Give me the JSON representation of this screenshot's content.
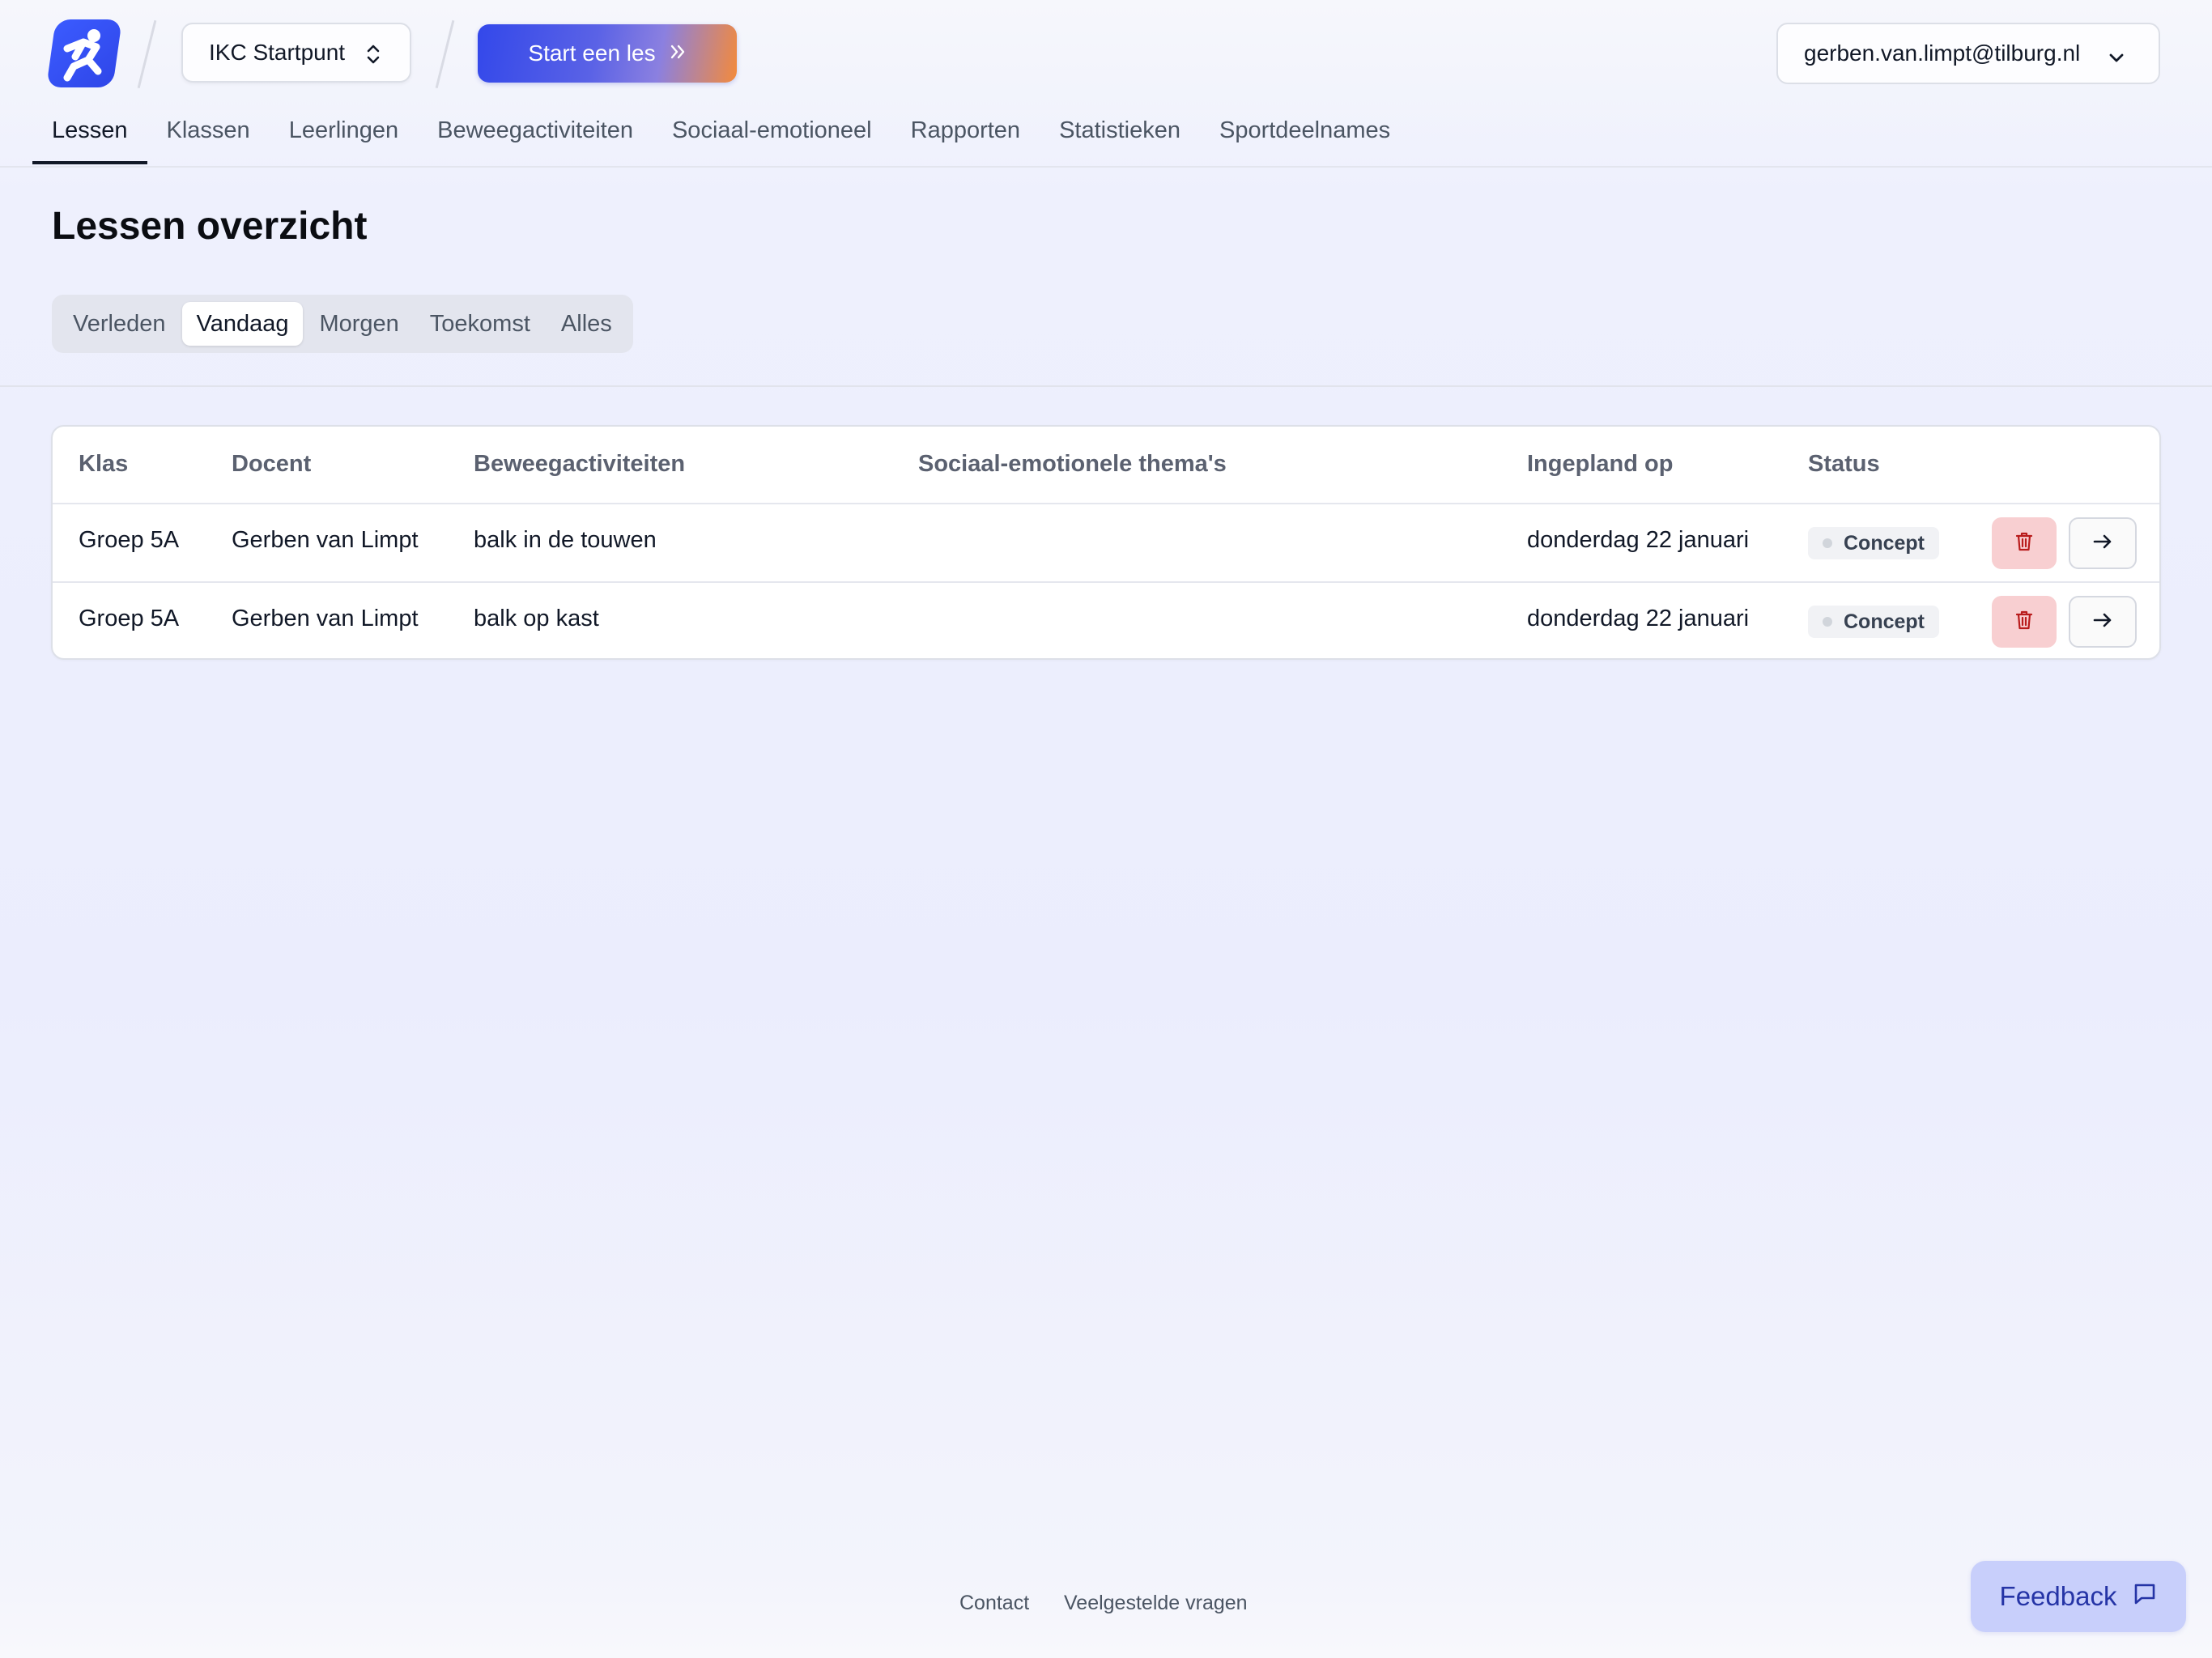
{
  "header": {
    "school_select_label": "IKC Startpunt",
    "start_button_label": "Start een les",
    "user_email": "gerben.van.limpt@tilburg.nl"
  },
  "nav": {
    "items": [
      "Lessen",
      "Klassen",
      "Leerlingen",
      "Beweegactiviteiten",
      "Sociaal-emotioneel",
      "Rapporten",
      "Statistieken",
      "Sportdeelnames"
    ],
    "active": "Lessen"
  },
  "page": {
    "title": "Lessen overzicht"
  },
  "tabs": {
    "items": [
      "Verleden",
      "Vandaag",
      "Morgen",
      "Toekomst",
      "Alles"
    ],
    "active": "Vandaag"
  },
  "table": {
    "headers": [
      "Klas",
      "Docent",
      "Beweegactiviteiten",
      "Sociaal-emotionele thema's",
      "Ingepland op",
      "Status"
    ],
    "rows": [
      {
        "klas": "Groep 5A",
        "docent": "Gerben van Limpt",
        "beweegactiviteiten": "balk in de touwen",
        "thema": "",
        "ingepland": "donderdag 22 januari",
        "status": "Concept"
      },
      {
        "klas": "Groep 5A",
        "docent": "Gerben van Limpt",
        "beweegactiviteiten": "balk op kast",
        "thema": "",
        "ingepland": "donderdag 22 januari",
        "status": "Concept"
      }
    ]
  },
  "footer": {
    "contact": "Contact",
    "faq": "Veelgestelde vragen",
    "feedback": "Feedback"
  },
  "icons": {
    "logo": "runner-logo-icon",
    "school_chevron": "chevron-up-down-icon",
    "start_arrows": "double-chevron-right-icon",
    "user_chevron": "chevron-down-icon",
    "delete": "trash-icon",
    "open": "arrow-right-icon",
    "feedback": "message-square-icon"
  },
  "colors": {
    "brand_blue": "#3348ea",
    "brand_orange": "#f38a3c",
    "delete_bg": "#f8cfd1",
    "delete_icon": "#b91c1c",
    "feedback_bg": "#c8cffb",
    "feedback_text": "#2534a6"
  }
}
